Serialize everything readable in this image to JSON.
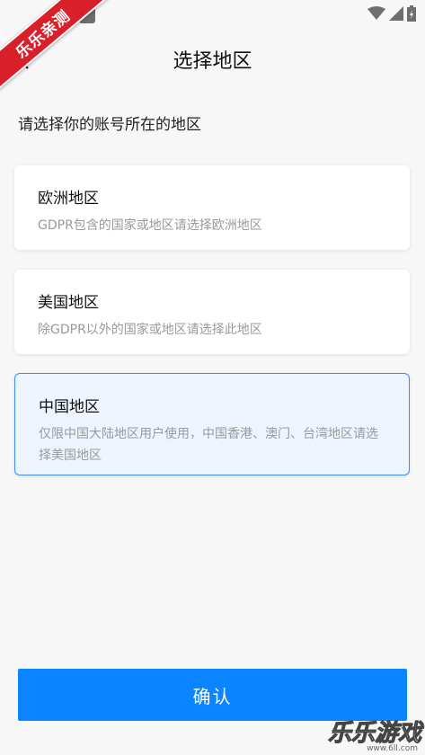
{
  "header": {
    "title": "选择地区",
    "subtitle": "请选择你的账号所在的地区"
  },
  "regions": [
    {
      "name": "欧洲地区",
      "desc": "GDPR包含的国家或地区请选择欧洲地区",
      "selected": false
    },
    {
      "name": "美国地区",
      "desc": "除GDPR以外的国家或地区请选择此地区",
      "selected": false
    },
    {
      "name": "中国地区",
      "desc": "仅限中国大陆地区用户使用，中国香港、澳门、台湾地区请选择美国地区",
      "selected": true
    }
  ],
  "confirm_label": "确认",
  "ribbon_text": "乐乐亲测",
  "watermark": {
    "logo": "乐乐游戏",
    "url": "www.6ll.com"
  },
  "colors": {
    "accent": "#0a84ff",
    "selected_bg": "#edf4fe",
    "ribbon": "#d9202a"
  }
}
